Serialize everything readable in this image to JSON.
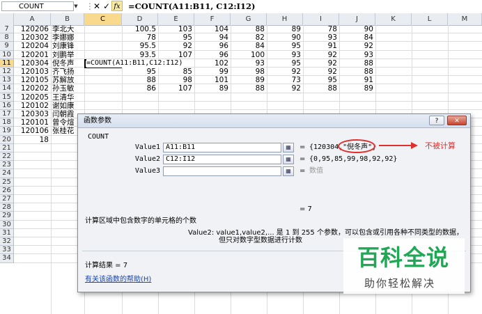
{
  "formula_bar": {
    "name_box": "COUNT",
    "cancel_symbol": "✕",
    "enter_symbol": "✓",
    "fx_symbol": "fx",
    "formula": "=COUNT(A11:B11, C12:I12)"
  },
  "columns": [
    "A",
    "B",
    "C",
    "D",
    "E",
    "F",
    "G",
    "H",
    "I",
    "J",
    "K",
    "L",
    "M"
  ],
  "rows": [
    {
      "n": "7",
      "a": "120206",
      "b": "李北大",
      "d": "100.5",
      "e": "103",
      "f": "104",
      "g": "88",
      "h": "89",
      "i": "78",
      "j": "90"
    },
    {
      "n": "8",
      "a": "120302",
      "b": "李娜娜",
      "d": "78",
      "e": "95",
      "f": "94",
      "g": "82",
      "h": "90",
      "i": "93",
      "j": "84"
    },
    {
      "n": "9",
      "a": "120204",
      "b": "刘康锋",
      "d": "95.5",
      "e": "92",
      "f": "96",
      "g": "84",
      "h": "95",
      "i": "91",
      "j": "92"
    },
    {
      "n": "10",
      "a": "120201",
      "b": "刘鹏举",
      "d": "93.5",
      "e": "107",
      "f": "96",
      "g": "100",
      "h": "93",
      "i": "92",
      "j": "93"
    },
    {
      "n": "11",
      "a": "120304",
      "b": "倪冬声",
      "c": "",
      "d": "",
      "e": "",
      "f": "102",
      "g": "93",
      "h": "95",
      "i": "92",
      "j": "88"
    },
    {
      "n": "12",
      "a": "120103",
      "b": "齐飞扬",
      "d": "95",
      "e": "85",
      "f": "99",
      "g": "98",
      "h": "92",
      "i": "92",
      "j": "88"
    },
    {
      "n": "13",
      "a": "120105",
      "b": "苏解放",
      "d": "88",
      "e": "98",
      "f": "101",
      "g": "89",
      "h": "73",
      "i": "95",
      "j": "91"
    },
    {
      "n": "14",
      "a": "120202",
      "b": "孙玉敏",
      "d": "86",
      "e": "107",
      "f": "89",
      "g": "88",
      "h": "92",
      "i": "88",
      "j": "89"
    },
    {
      "n": "15",
      "a": "120205",
      "b": "王清华"
    },
    {
      "n": "16",
      "a": "120102",
      "b": "谢如康"
    },
    {
      "n": "17",
      "a": "120303",
      "b": "闫朝霞"
    },
    {
      "n": "18",
      "a": "120101",
      "b": "曾令煊"
    },
    {
      "n": "19",
      "a": "120106",
      "b": "张桂花"
    },
    {
      "n": "20",
      "a": "18"
    },
    {
      "n": "21"
    },
    {
      "n": "22"
    },
    {
      "n": "23"
    },
    {
      "n": "24"
    },
    {
      "n": "25"
    },
    {
      "n": "26"
    },
    {
      "n": "27"
    },
    {
      "n": "28"
    },
    {
      "n": "29"
    },
    {
      "n": "30"
    },
    {
      "n": "31"
    },
    {
      "n": "32"
    },
    {
      "n": "33"
    },
    {
      "n": "34"
    }
  ],
  "selected": {
    "column": "C",
    "row": "11"
  },
  "active_cell_text": "=COUNT(A11:B11,C12:I12)",
  "dialog": {
    "title": "函数参数",
    "help_button": "?",
    "close_button": "✕",
    "function_name": "COUNT",
    "args": [
      {
        "label": "Value1",
        "input": "A11:B11",
        "ref_icon": "range-select-icon",
        "result": "{120304,\"倪冬声\"}"
      },
      {
        "label": "Value2",
        "input": "C12:I12",
        "ref_icon": "range-select-icon",
        "result": "{0,95,85,99,98,92,92}"
      },
      {
        "label": "Value3",
        "input": "",
        "ref_icon": "range-select-icon",
        "result": "数值"
      }
    ],
    "equals": "=",
    "annotation": "不被计算",
    "annotation_color": "#e0302d",
    "result_preview": "=  7",
    "description": "计算区域中包含数字的单元格的个数",
    "detail_line1": "Value2:  value1,value2,... 是 1 到 255 个参数，可以包含或引用各种不同类型的数据，",
    "detail_line2": "但只对数字型数据进行计数",
    "calc_result": "计算结果 =  7",
    "help_link": "有关该函数的帮助(H)"
  },
  "watermark": {
    "title": "百科全说",
    "subtitle": "助你轻松解决",
    "color": "#20a857"
  }
}
